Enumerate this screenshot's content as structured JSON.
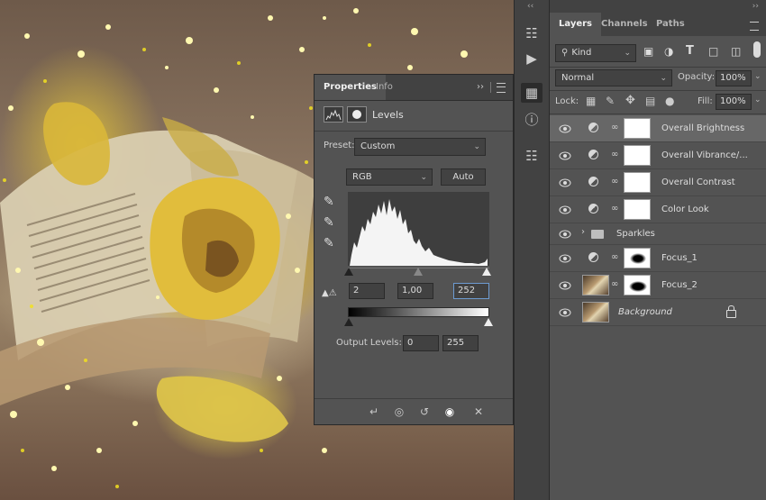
{
  "canvas": {
    "image": "book-with-yellow-tulip-and-sparkles"
  },
  "properties": {
    "tabs": [
      "Properties",
      "Info"
    ],
    "adjustment_title": "Levels",
    "preset_label": "Preset:",
    "preset_value": "Custom",
    "channel": "RGB",
    "auto_label": "Auto",
    "input_black": "2",
    "input_gamma": "1,00",
    "input_white": "252",
    "output_label": "Output Levels:",
    "output_black": "0",
    "output_white": "255"
  },
  "layers_panel": {
    "tabs": [
      "Layers",
      "Channels",
      "Paths"
    ],
    "filter_label": "Kind",
    "blend_mode": "Normal",
    "opacity_label": "Opacity:",
    "opacity_value": "100%",
    "lock_label": "Lock:",
    "fill_label": "Fill:",
    "fill_value": "100%",
    "layers": [
      {
        "name": "Overall Brightness",
        "type": "adjustment",
        "selected": true
      },
      {
        "name": "Overall Vibrance/...",
        "type": "adjustment"
      },
      {
        "name": "Overall Contrast",
        "type": "adjustment"
      },
      {
        "name": "Color Look",
        "type": "adjustment"
      },
      {
        "name": "Sparkles",
        "type": "group"
      },
      {
        "name": "Focus_1",
        "type": "adjustment"
      },
      {
        "name": "Focus_2",
        "type": "image"
      },
      {
        "name": "Background",
        "type": "background",
        "locked": true
      }
    ]
  },
  "colors": {
    "panel": "#535353",
    "panel_dark": "#424242",
    "selected_row": "#676767",
    "focus_border": "#6d9bd1"
  }
}
